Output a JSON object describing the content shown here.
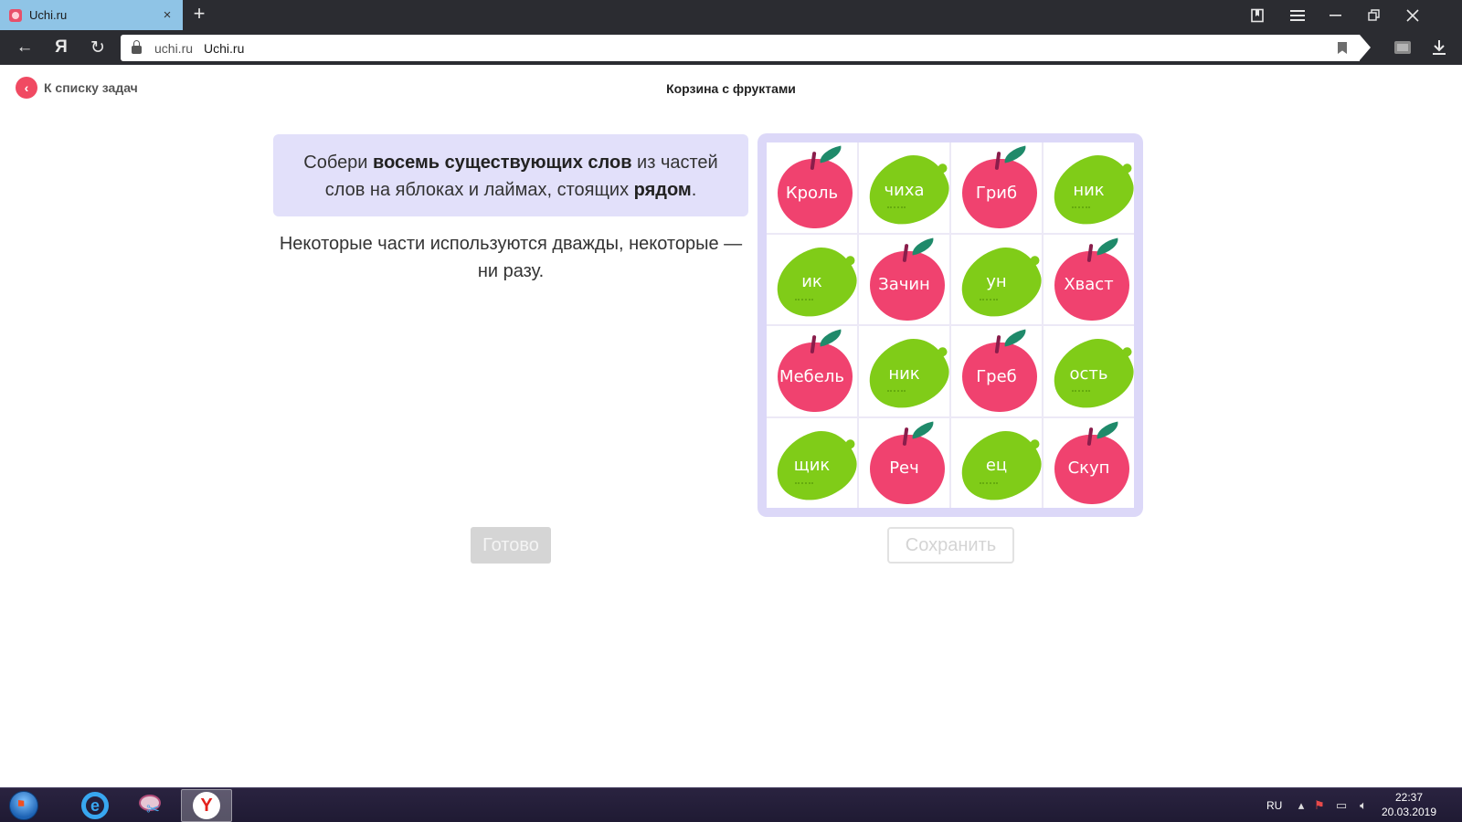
{
  "browser": {
    "tab_title": "Uchi.ru",
    "tab_close": "×",
    "new_tab": "+",
    "address_domain": "uchi.ru",
    "address_title": "Uchi.ru",
    "back_glyph": "←",
    "yandex_glyph": "Я",
    "reload_glyph": "↻",
    "download_glyph": "⭳"
  },
  "page": {
    "back_link": "К списку задач",
    "title": "Корзина с фруктами",
    "task_text_1": "Собери ",
    "task_bold_1": "восемь существующих слов",
    "task_text_2": " из частей слов на яблоках и лаймах, стоящих ",
    "task_bold_2": "рядом",
    "task_text_3": ".",
    "hint": "Некоторые части используются дважды, некоторые — ни разу.",
    "done_button": "Готово",
    "save_button": "Сохранить"
  },
  "grid": [
    [
      {
        "text": "Кроль",
        "fruit": "apple"
      },
      {
        "text": "чиха",
        "fruit": "lime"
      },
      {
        "text": "Гриб",
        "fruit": "apple"
      },
      {
        "text": "ник",
        "fruit": "lime"
      }
    ],
    [
      {
        "text": "ик",
        "fruit": "lime"
      },
      {
        "text": "Зачин",
        "fruit": "apple"
      },
      {
        "text": "ун",
        "fruit": "lime"
      },
      {
        "text": "Хваст",
        "fruit": "apple"
      }
    ],
    [
      {
        "text": "Мебель",
        "fruit": "apple"
      },
      {
        "text": "ник",
        "fruit": "lime"
      },
      {
        "text": "Греб",
        "fruit": "apple"
      },
      {
        "text": "ость",
        "fruit": "lime"
      }
    ],
    [
      {
        "text": "щик",
        "fruit": "lime"
      },
      {
        "text": "Реч",
        "fruit": "apple"
      },
      {
        "text": "ец",
        "fruit": "lime"
      },
      {
        "text": "Скуп",
        "fruit": "apple"
      }
    ]
  ],
  "colors": {
    "apple": "#f0426f",
    "lime": "#80cc18",
    "task_box": "#e2e0fa",
    "board": "#dcd8f8",
    "accent": "#f04a62"
  },
  "taskbar": {
    "language": "RU",
    "time": "22:37",
    "date": "20.03.2019",
    "apps": [
      "internet-explorer-icon",
      "snipping-tool-icon",
      "yandex-browser-icon"
    ]
  }
}
